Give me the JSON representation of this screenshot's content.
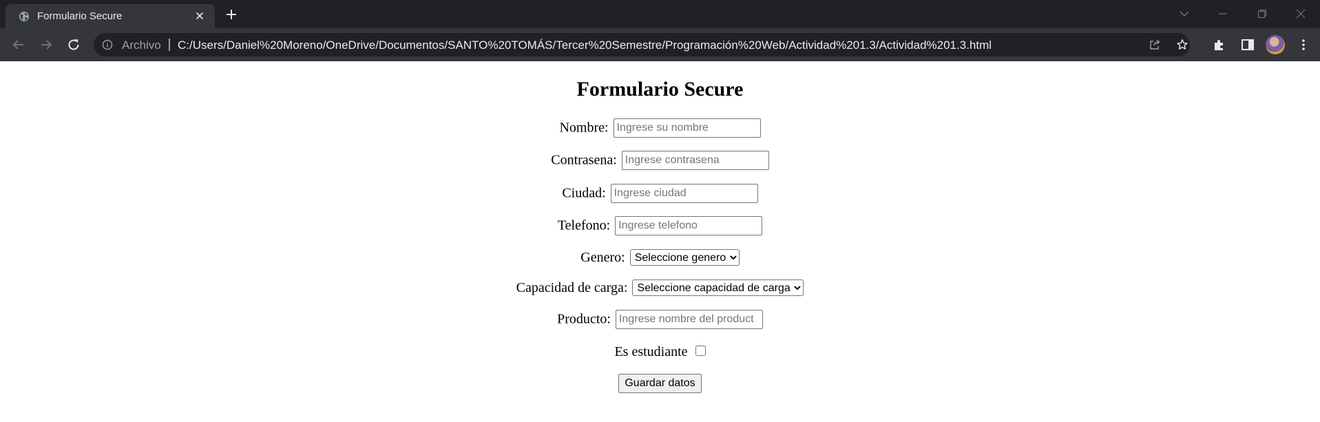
{
  "browser": {
    "tab_title": "Formulario Secure",
    "scheme_label": "Archivo",
    "url": "C:/Users/Daniel%20Moreno/OneDrive/Documentos/SANTO%20TOMÁS/Tercer%20Semestre/Programación%20Web/Actividad%201.3/Actividad%201.3.html",
    "colors": {
      "tabstrip": "#202124",
      "toolbar": "#35363a",
      "text": "#e8eaed"
    },
    "icons": [
      "globe-icon",
      "close-icon",
      "plus-icon",
      "chevron-down-icon",
      "minimize-icon",
      "restore-icon",
      "back-icon",
      "forward-icon",
      "reload-icon",
      "info-icon",
      "share-icon",
      "star-icon",
      "extensions-icon",
      "side-panel-icon",
      "menu-icon"
    ]
  },
  "form": {
    "title": "Formulario Secure",
    "nombre": {
      "label": "Nombre:",
      "placeholder": "Ingrese su nombre"
    },
    "contrasena": {
      "label": "Contrasena:",
      "placeholder": "Ingrese contrasena"
    },
    "ciudad": {
      "label": "Ciudad:",
      "placeholder": "Ingrese ciudad"
    },
    "telefono": {
      "label": "Telefono:",
      "placeholder": "Ingrese telefono"
    },
    "genero": {
      "label": "Genero:",
      "selected": "Seleccione genero"
    },
    "capacidad": {
      "label": "Capacidad de carga:",
      "selected": "Seleccione capacidad de carga"
    },
    "producto": {
      "label": "Producto:",
      "placeholder": "Ingrese nombre del product"
    },
    "estudiante": {
      "label": "Es estudiante",
      "checked": false
    },
    "submit_label": "Guardar datos"
  }
}
